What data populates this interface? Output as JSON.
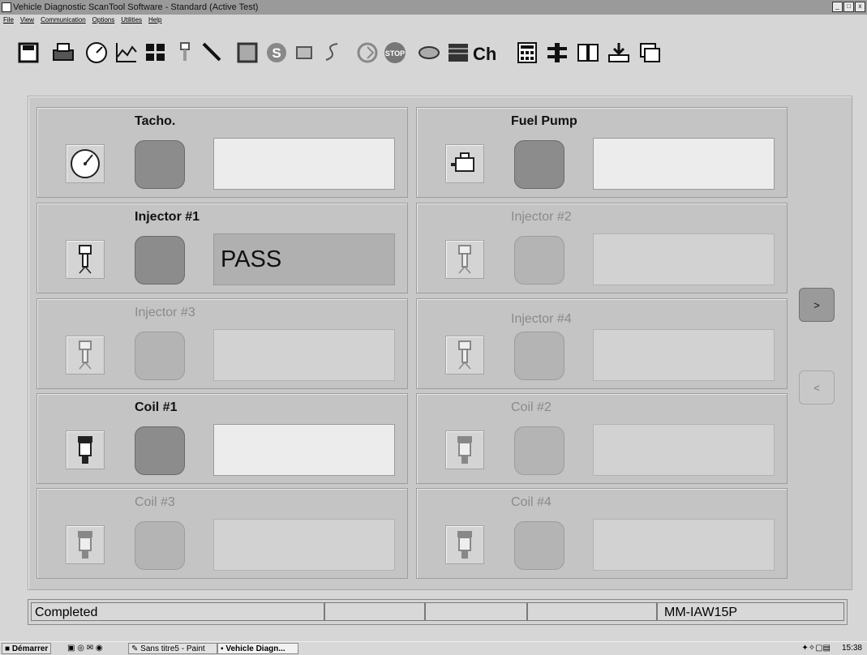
{
  "window": {
    "title": "Vehicle Diagnostic ScanTool Software - Standard (Active Test)",
    "controls": [
      "_",
      "□",
      "x"
    ]
  },
  "menu": [
    "File",
    "View",
    "Communication",
    "Options",
    "Utilities",
    "Help"
  ],
  "toolbar": {
    "icons": [
      "save-icon",
      "print-icon",
      "gauge-icon",
      "graph-icon",
      "grid-icon",
      "injector-icon",
      "probe-icon",
      "frame-icon",
      "s-icon",
      "engine-icon",
      "cable-icon",
      "refresh-icon",
      "stop-icon",
      "sensor-icon",
      "battery-icon",
      "calculator-icon",
      "wiring-icon",
      "book-icon",
      "download-icon",
      "window-icon"
    ],
    "ch_label": "Ch",
    "stop_label": "STOP"
  },
  "cards": [
    {
      "title": "Tacho.",
      "icon": "tachometer-icon",
      "result": "",
      "enabled": true,
      "filled": false
    },
    {
      "title": "Fuel Pump",
      "icon": "fuel-pump-icon",
      "result": "",
      "enabled": true,
      "filled": false
    },
    {
      "title": "Injector #1",
      "icon": "injector-icon",
      "result": "PASS",
      "enabled": true,
      "filled": true
    },
    {
      "title": "Injector #2",
      "icon": "injector-icon",
      "result": "",
      "enabled": false,
      "filled": false
    },
    {
      "title": "Injector #3",
      "icon": "injector-icon",
      "result": "",
      "enabled": false,
      "filled": false
    },
    {
      "title": "Injector #4",
      "icon": "injector-icon",
      "result": "",
      "enabled": false,
      "filled": false
    },
    {
      "title": "Coil #1",
      "icon": "coil-icon",
      "result": "",
      "enabled": true,
      "filled": false
    },
    {
      "title": "Coil #2",
      "icon": "coil-icon",
      "result": "",
      "enabled": false,
      "filled": false
    },
    {
      "title": "Coil #3",
      "icon": "coil-icon",
      "result": "",
      "enabled": false,
      "filled": false
    },
    {
      "title": "Coil #4",
      "icon": "coil-icon",
      "result": "",
      "enabled": false,
      "filled": false
    }
  ],
  "nav": {
    "next": ">",
    "prev": "<"
  },
  "status": {
    "message": "Completed",
    "ecu": "MM-IAW15P"
  },
  "taskbar": {
    "start": "Démarrer",
    "tasks": [
      "Sans titre5 - Paint",
      "Vehicle Diagn..."
    ],
    "clock": "15:38"
  }
}
